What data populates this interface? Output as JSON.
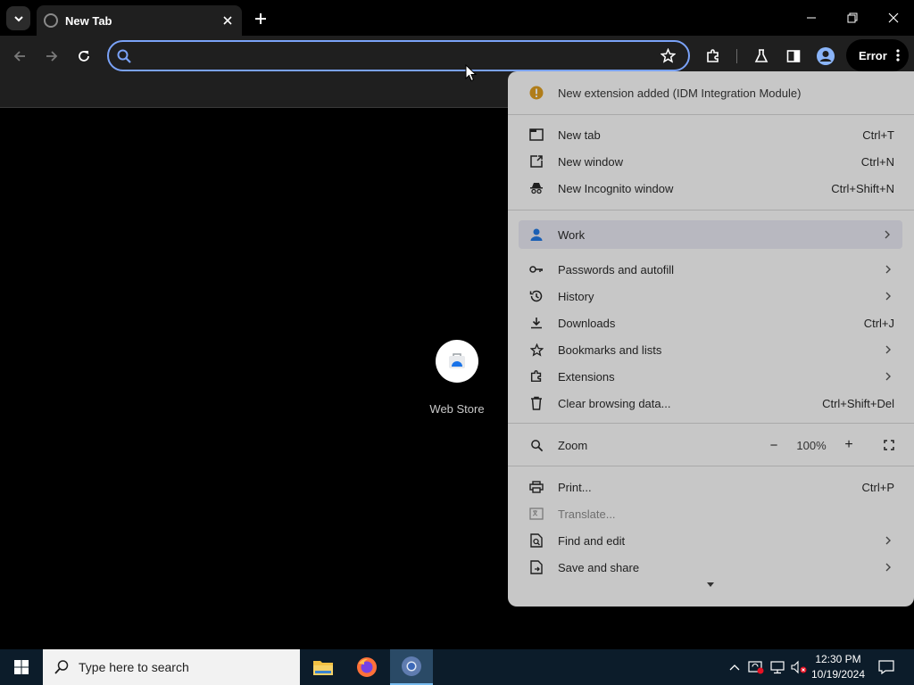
{
  "tab": {
    "title": "New Tab"
  },
  "omnibox": {
    "value": ""
  },
  "profile_button": {
    "label": "Error"
  },
  "shortcut": {
    "label": "Web Store"
  },
  "menu": {
    "notification": "New extension added (IDM Integration Module)",
    "items_group1": [
      {
        "label": "New tab",
        "shortcut": "Ctrl+T"
      },
      {
        "label": "New window",
        "shortcut": "Ctrl+N"
      },
      {
        "label": "New Incognito window",
        "shortcut": "Ctrl+Shift+N"
      }
    ],
    "profile": {
      "label": "Work"
    },
    "items_group2": [
      {
        "label": "Passwords and autofill",
        "shortcut": ""
      },
      {
        "label": "History",
        "shortcut": ""
      },
      {
        "label": "Downloads",
        "shortcut": "Ctrl+J"
      },
      {
        "label": "Bookmarks and lists",
        "shortcut": ""
      },
      {
        "label": "Extensions",
        "shortcut": ""
      },
      {
        "label": "Clear browsing data...",
        "shortcut": "Ctrl+Shift+Del"
      }
    ],
    "zoom": {
      "label": "Zoom",
      "minus": "−",
      "value": "100%",
      "plus": "+"
    },
    "items_group3": [
      {
        "label": "Print...",
        "shortcut": "Ctrl+P"
      },
      {
        "label": "Translate...",
        "shortcut": ""
      },
      {
        "label": "Find and edit",
        "shortcut": ""
      },
      {
        "label": "Save and share",
        "shortcut": ""
      }
    ]
  },
  "taskbar": {
    "search_placeholder": "Type here to search",
    "time": "12:30 PM",
    "date": "10/19/2024"
  },
  "colors": {
    "accent": "#7aa2f7",
    "menu_bg": "#c7c7c7",
    "taskbar_bg": "#0c1c2a",
    "warning": "#b07d1a"
  }
}
